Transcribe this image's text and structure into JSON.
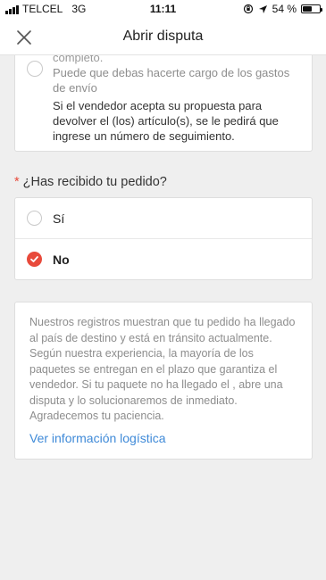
{
  "status_bar": {
    "carrier": "TELCEL",
    "network": "3G",
    "time": "11:11",
    "battery_percent_label": "54 %",
    "battery_level": 0.54
  },
  "header": {
    "title": "Abrir disputa",
    "close_icon": "close-icon"
  },
  "option_card": {
    "faded_line": "completo.",
    "description": "Puede que debas hacerte cargo de los gastos de envío",
    "info": "Si el vendedor acepta su propuesta para devolver el (los) artículo(s), se le pedirá que ingrese un número de seguimiento."
  },
  "question": {
    "required_mark": "*",
    "text": "¿Has recibido tu pedido?",
    "options": [
      {
        "label": "Sí",
        "selected": false
      },
      {
        "label": "No",
        "selected": true
      }
    ]
  },
  "info_card": {
    "text": "Nuestros registros muestran que tu pedido ha llegado al país de destino y está en tránsito actualmente. Según nuestra experiencia, la mayoría de los paquetes se entregan en el plazo que garantiza el vendedor. Si tu paquete no ha llegado el , abre una disputa y lo solucionaremos de inmediato. Agradecemos tu paciencia.",
    "link": "Ver información logística"
  },
  "colors": {
    "accent": "#e84a3b",
    "link": "#3f8ad8",
    "background": "#efefef"
  }
}
